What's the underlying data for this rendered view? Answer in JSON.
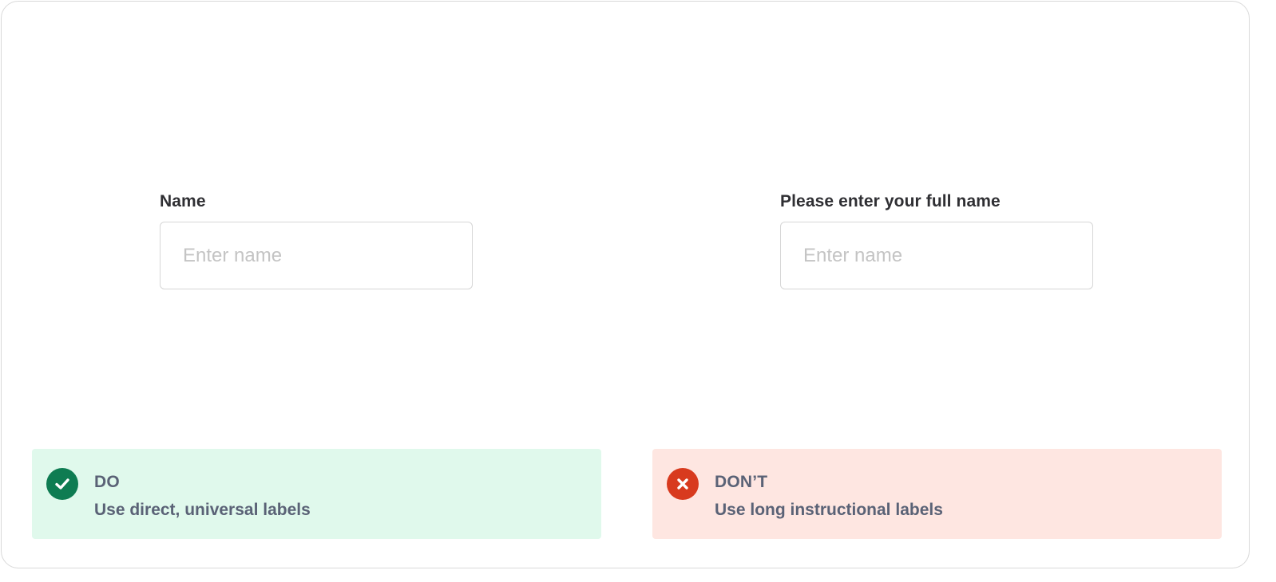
{
  "examples": {
    "good": {
      "label": "Name",
      "placeholder": "Enter name",
      "value": ""
    },
    "bad": {
      "label": "Please enter your full name",
      "placeholder": "Enter name",
      "value": ""
    }
  },
  "guidance": {
    "do": {
      "icon": "check-circle-icon",
      "title": "DO",
      "text": "Use direct, universal labels",
      "background": "#e0f9ec",
      "icon_color": "#0e7c52"
    },
    "dont": {
      "icon": "x-circle-icon",
      "title": "DON’T",
      "text": "Use long instructional labels",
      "background": "#fee6e1",
      "icon_color": "#d83a1e"
    }
  }
}
